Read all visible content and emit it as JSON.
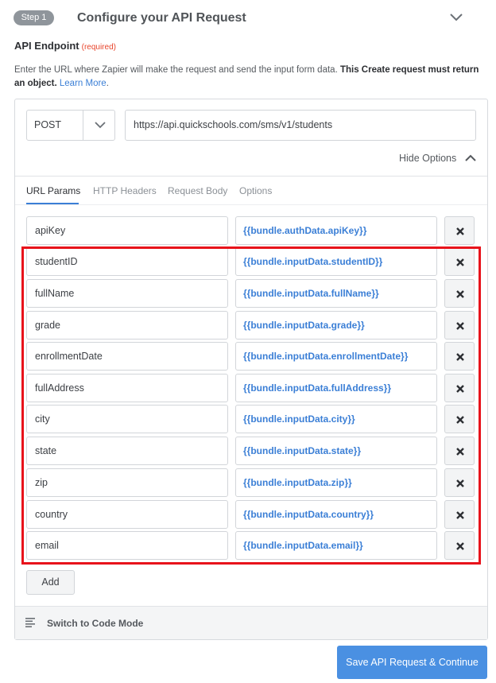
{
  "step": {
    "badge": "Step 1",
    "title": "Configure your API Request",
    "collapse_icon": "chevron-down-icon"
  },
  "endpoint": {
    "label": "API Endpoint",
    "required": "(required)",
    "help_text": "Enter the URL where Zapier will make the request and send the input form data.",
    "help_bold": "This Create request must return an object.",
    "learn_more": "Learn More",
    "after_link": ".",
    "method": "POST",
    "url": "https://api.quickschools.com/sms/v1/students"
  },
  "options": {
    "toggle_label": "Hide Options",
    "toggle_icon": "chevron-up-icon"
  },
  "tabs": [
    {
      "label": "URL Params",
      "active": true
    },
    {
      "label": "HTTP Headers",
      "active": false
    },
    {
      "label": "Request Body",
      "active": false
    },
    {
      "label": "Options",
      "active": false
    }
  ],
  "params": [
    {
      "key": "apiKey",
      "value": "{{bundle.authData.apiKey}}"
    },
    {
      "key": "studentID",
      "value": "{{bundle.inputData.studentID}}"
    },
    {
      "key": "fullName",
      "value": "{{bundle.inputData.fullName}}"
    },
    {
      "key": "grade",
      "value": "{{bundle.inputData.grade}}"
    },
    {
      "key": "enrollmentDate",
      "value": "{{bundle.inputData.enrollmentDate}}"
    },
    {
      "key": "fullAddress",
      "value": "{{bundle.inputData.fullAddress}}"
    },
    {
      "key": "city",
      "value": "{{bundle.inputData.city}}"
    },
    {
      "key": "state",
      "value": "{{bundle.inputData.state}}"
    },
    {
      "key": "zip",
      "value": "{{bundle.inputData.zip}}"
    },
    {
      "key": "country",
      "value": "{{bundle.inputData.country}}"
    },
    {
      "key": "email",
      "value": "{{bundle.inputData.email}}"
    }
  ],
  "add_label": "Add",
  "code_mode": {
    "label": "Switch to Code Mode",
    "icon": "code-lines-icon"
  },
  "save_label": "Save API Request & Continue",
  "colors": {
    "accent": "#4a90e2",
    "link": "#3b7fd6",
    "highlight": "#e8131b",
    "required": "#e8442b"
  }
}
